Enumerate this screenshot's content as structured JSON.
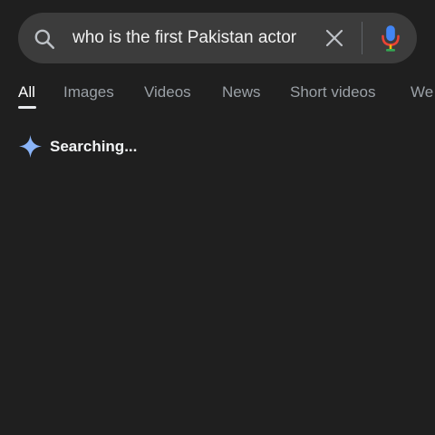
{
  "search": {
    "query": "who is the first Pakistan actor",
    "search_icon": "search-icon",
    "clear_icon": "close-icon",
    "mic_icon": "mic-icon"
  },
  "tabs": [
    {
      "label": "All",
      "active": true
    },
    {
      "label": "Images",
      "active": false
    },
    {
      "label": "Videos",
      "active": false
    },
    {
      "label": "News",
      "active": false
    },
    {
      "label": "Short videos",
      "active": false
    },
    {
      "label": "We",
      "active": false
    }
  ],
  "status": {
    "text": "Searching...",
    "icon": "sparkle-icon"
  },
  "colors": {
    "background": "#1f1f1f",
    "search_bar": "#3c3c3c",
    "sparkle": "#8ab4f8",
    "mic_blue": "#4285f4",
    "mic_red": "#ea4335",
    "tab_inactive": "#9aa0a6",
    "tab_active": "#ffffff"
  }
}
